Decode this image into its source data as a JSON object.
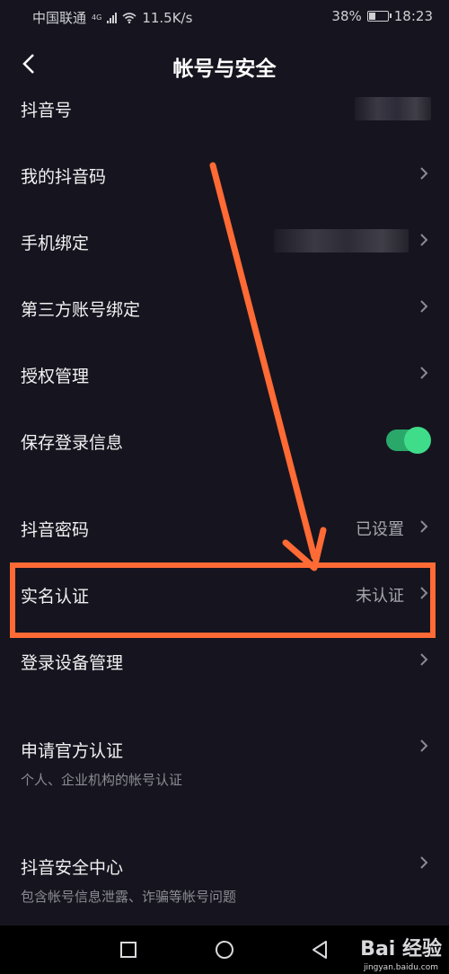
{
  "status": {
    "carrier": "中国联通",
    "net": "4G",
    "speed": "11.5K/s",
    "battery": "38%",
    "battery_level": 0.38,
    "time": "18:23"
  },
  "header": {
    "title": "帐号与安全"
  },
  "rows": [
    {
      "label": "抖音号"
    },
    {
      "label": "我的抖音码"
    },
    {
      "label": "手机绑定"
    },
    {
      "label": "第三方账号绑定"
    },
    {
      "label": "授权管理"
    },
    {
      "label": "保存登录信息",
      "toggle_on": true
    },
    {
      "label": "抖音密码",
      "value": "已设置"
    },
    {
      "label": "实名认证",
      "value": "未认证"
    },
    {
      "label": "登录设备管理"
    },
    {
      "label": "申请官方认证",
      "sub": "个人、企业机构的帐号认证"
    },
    {
      "label": "抖音安全中心",
      "sub": "包含帐号信息泄露、诈骗等帐号问题"
    }
  ],
  "watermark": {
    "brand": "Bai 经验",
    "url": "jingyan.baidu.com"
  },
  "colors": {
    "accent": "#ff6a35",
    "toggle": "#3fdc8a",
    "background": "#16151f"
  }
}
